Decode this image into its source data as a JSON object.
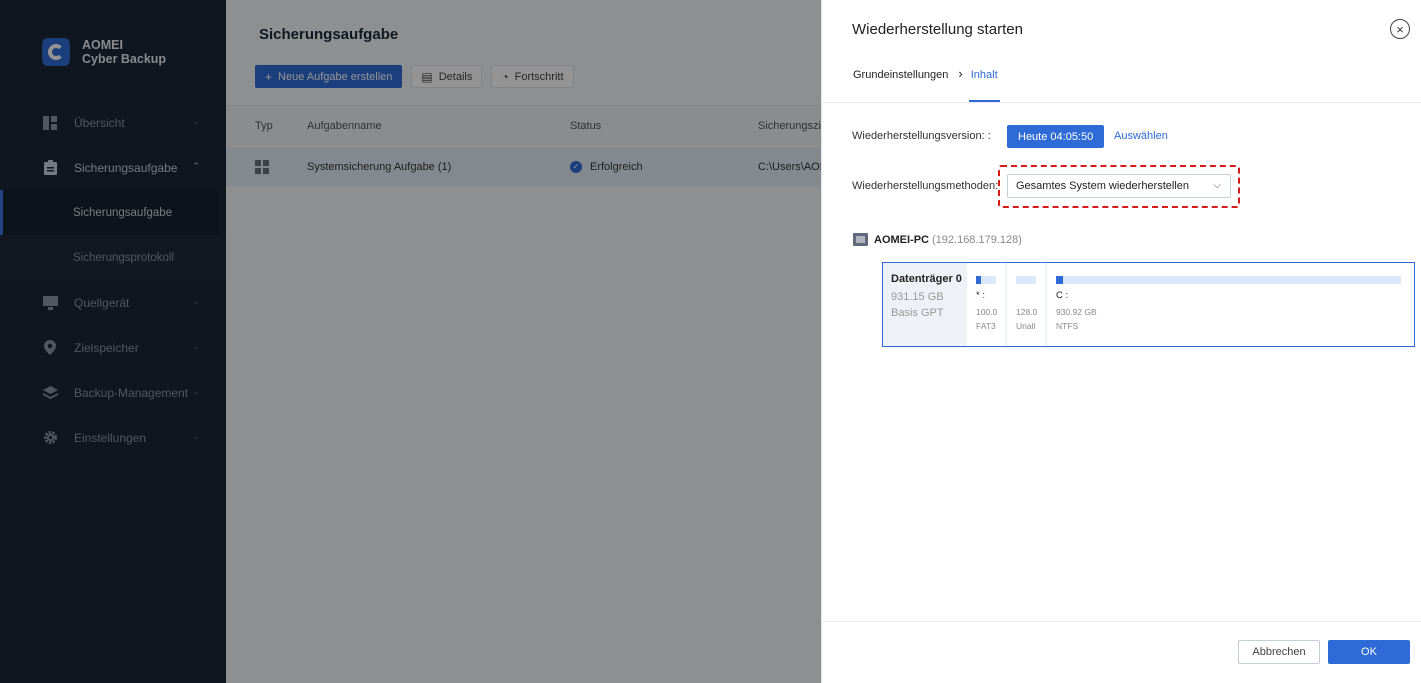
{
  "app": {
    "brand_line1": "AOMEI",
    "brand_line2": "Cyber Backup"
  },
  "sidebar": {
    "items": [
      {
        "label": "Übersicht",
        "icon": "dashboard-icon"
      },
      {
        "label": "Sicherungsaufgabe",
        "icon": "clipboard-icon",
        "expanded": true,
        "children": [
          {
            "label": "Sicherungsaufgabe",
            "active": true
          },
          {
            "label": "Sicherungsprotokoll"
          }
        ]
      },
      {
        "label": "Quellgerät",
        "icon": "monitor-icon"
      },
      {
        "label": "Zielspeicher",
        "icon": "location-pin-icon"
      },
      {
        "label": "Backup-Management",
        "icon": "layers-icon"
      },
      {
        "label": "Einstellungen",
        "icon": "gear-icon"
      }
    ]
  },
  "main": {
    "title": "Sicherungsaufgabe",
    "toolbar": {
      "new_task": "Neue Aufgabe erstellen",
      "details": "Details",
      "progress": "Fortschritt"
    },
    "table": {
      "headers": {
        "typ": "Typ",
        "name": "Aufgabenname",
        "status": "Status",
        "ziel": "Sicherungsziel"
      },
      "rows": [
        {
          "name": "Systemsicherung Aufgabe (1)",
          "status": "Erfolgreich",
          "ziel": "C:\\Users\\AOMEI"
        }
      ]
    }
  },
  "dialog": {
    "title": "Wiederherstellung starten",
    "steps": {
      "step1": "Grundeinstellungen",
      "step2": "Inhalt"
    },
    "version_label": "Wiederherstellungsversion: :",
    "version_value": "Heute 04:05:50",
    "select_link": "Auswählen",
    "method_label": "Wiederherstellungsmethoden:",
    "method_value": "Gesamtes System wiederherstellen",
    "pc": {
      "name": "AOMEI-PC",
      "ip": "(192.168.179.128)"
    },
    "disk": {
      "name": "Datenträger 0",
      "size": "931.15 GB",
      "type": "Basis GPT",
      "partitions": [
        {
          "label": "* :",
          "size": "100.0",
          "fs": "FAT3",
          "fill": 0.15
        },
        {
          "label": "",
          "size": "128.0",
          "fs": "Unall",
          "fill": 0
        },
        {
          "label": "C :",
          "size": "930.92 GB",
          "fs": "NTFS",
          "fill": 0.02
        }
      ]
    },
    "buttons": {
      "cancel": "Abbrechen",
      "ok": "OK"
    }
  },
  "colors": {
    "accent": "#2f6bd6",
    "sidebar_bg": "#1b2738",
    "highlight": "#d61a1a"
  }
}
